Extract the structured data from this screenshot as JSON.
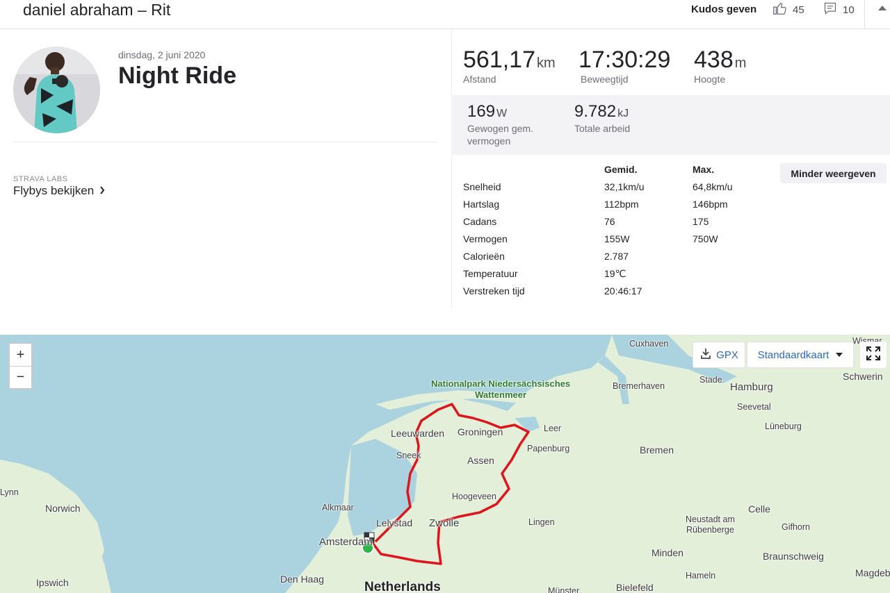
{
  "header": {
    "title": "daniel abraham – Rit",
    "kudos_give_label": "Kudos geven",
    "kudos_count": "45",
    "comment_count": "10"
  },
  "activity": {
    "date": "dinsdag, 2 juni 2020",
    "name": "Night Ride"
  },
  "labs": {
    "label": "STRAVA LABS",
    "flyby_link": "Flybys bekijken"
  },
  "primary_stats": [
    {
      "value": "561,17",
      "unit": "km",
      "label": "Afstand"
    },
    {
      "value": "17:30:29",
      "unit": "",
      "label": "Beweegtijd"
    },
    {
      "value": "438",
      "unit": "m",
      "label": "Hoogte"
    }
  ],
  "secondary_stats": [
    {
      "value": "169",
      "unit": "W",
      "label_line1": "Gewogen gem.",
      "label_line2": "vermogen"
    },
    {
      "value": "9.782",
      "unit": "kJ",
      "label_line1": "Totale arbeid",
      "label_line2": ""
    }
  ],
  "table": {
    "col_avg": "Gemid.",
    "col_max": "Max.",
    "rows": [
      {
        "label": "Snelheid",
        "avg": "32,1km/u",
        "max": "64,8km/u"
      },
      {
        "label": "Hartslag",
        "avg": "112bpm",
        "max": "146bpm"
      },
      {
        "label": "Cadans",
        "avg": "76",
        "max": "175"
      },
      {
        "label": "Vermogen",
        "avg": "155W",
        "max": "750W"
      },
      {
        "label": "Calorieën",
        "avg": "2.787",
        "max": ""
      },
      {
        "label": "Temperatuur",
        "avg": "19℃",
        "max": ""
      },
      {
        "label": "Verstreken tijd",
        "avg": "20:46:17",
        "max": ""
      }
    ],
    "less_button": "Minder weergeven"
  },
  "map": {
    "zoom_in": "+",
    "zoom_out": "−",
    "gpx_label": "GPX",
    "map_type": "Standaardkaart",
    "water_color": "#aad3df",
    "land_color": "#e3efd9",
    "route_color": "#e0141c",
    "labels": {
      "cuxhaven": "Cuxhaven",
      "wismar": "Wismar",
      "stade": "Stade",
      "hamburg": "Hamburg",
      "schwerin": "Schwerin",
      "bremerhaven": "Bremerhaven",
      "seevetal": "Seevetal",
      "park_line1": "Nationalpark Niedersächsisches",
      "park_line2": "Wattenmeer",
      "leer": "Leer",
      "luneburg": "Lüneburg",
      "leeuwarden": "Leeuwarden",
      "groningen": "Groningen",
      "papenburg": "Papenburg",
      "bremen": "Bremen",
      "sneek": "Sneek",
      "assen": "Assen",
      "lynn": "Lynn",
      "norwich": "Norwich",
      "alkmaar": "Alkmaar",
      "hoogeveen": "Hoogeveen",
      "celle": "Celle",
      "lelystad": "Lelystad",
      "zwolle": "Zwolle",
      "lingen": "Lingen",
      "neustadt_line1": "Neustadt am",
      "neustadt_line2": "Rübenberge",
      "gifhorn": "Gifhorn",
      "amsterdam": "Amsterdam",
      "minden": "Minden",
      "braunschweig": "Braunschweig",
      "ipswich": "Ipswich",
      "den_haag": "Den Haag",
      "hameln": "Hameln",
      "magdeburg": "Magdeb",
      "netherlands": "Netherlands",
      "bielefeld": "Bielefeld",
      "munster": "Münster"
    }
  }
}
